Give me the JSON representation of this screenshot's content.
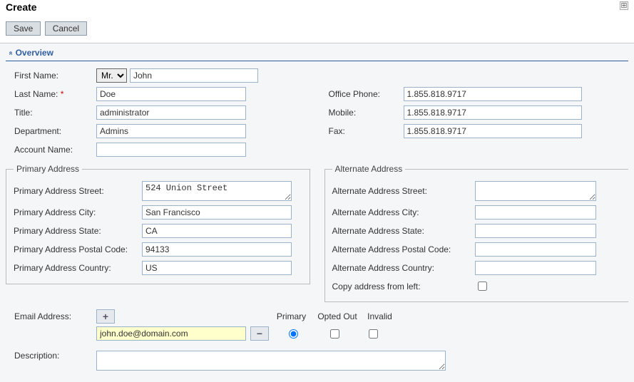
{
  "header": {
    "title": "Create"
  },
  "actions": {
    "save": "Save",
    "cancel": "Cancel"
  },
  "section": {
    "overview": "Overview"
  },
  "labels": {
    "first_name": "First Name:",
    "last_name": "Last Name:",
    "last_name_req": "*",
    "title": "Title:",
    "department": "Department:",
    "account_name": "Account Name:",
    "office_phone": "Office Phone:",
    "mobile": "Mobile:",
    "fax": "Fax:",
    "primary_address": "Primary Address",
    "p_street": "Primary Address Street:",
    "p_city": "Primary Address City:",
    "p_state": "Primary Address State:",
    "p_postal": "Primary Address Postal Code:",
    "p_country": "Primary Address Country:",
    "alternate_address": "Alternate Address",
    "a_street": "Alternate Address Street:",
    "a_city": "Alternate Address City:",
    "a_state": "Alternate Address State:",
    "a_postal": "Alternate Address Postal Code:",
    "a_country": "Alternate Address Country:",
    "copy_left": "Copy address from left:",
    "email_address": "Email Address:",
    "primary_col": "Primary",
    "opted_out_col": "Opted Out",
    "invalid_col": "Invalid",
    "description": "Description:"
  },
  "values": {
    "salutation": "Mr.",
    "first_name": "John",
    "last_name": "Doe",
    "title": "administrator",
    "department": "Admins",
    "account_name": "",
    "office_phone": "1.855.818.9717",
    "mobile": "1.855.818.9717",
    "fax": "1.855.818.9717",
    "p_street": "524 Union Street",
    "p_city": "San Francisco",
    "p_state": "CA",
    "p_postal": "94133",
    "p_country": "US",
    "a_street": "",
    "a_city": "",
    "a_state": "",
    "a_postal": "",
    "a_country": "",
    "copy_left": false,
    "email": "john.doe@domain.com",
    "email_primary": true,
    "email_opted_out": false,
    "email_invalid": false,
    "description": ""
  },
  "icons": {
    "expand": "☒",
    "plus": "+",
    "minus": "−",
    "chevron": "«"
  }
}
